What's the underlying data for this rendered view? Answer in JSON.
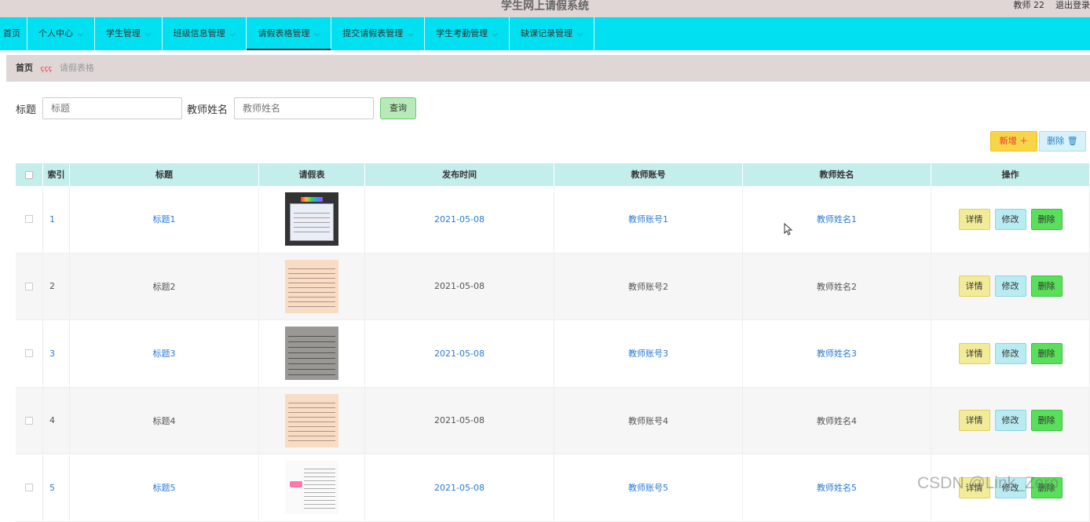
{
  "header": {
    "title": "学生网上请假系统",
    "user": "教师 22",
    "logout": "退出登录"
  },
  "nav": {
    "items": [
      {
        "label": "首页",
        "has_menu": false
      },
      {
        "label": "个人中心",
        "has_menu": true
      },
      {
        "label": "学生管理",
        "has_menu": true
      },
      {
        "label": "班级信息管理",
        "has_menu": true
      },
      {
        "label": "请假表格管理",
        "has_menu": true,
        "active": true
      },
      {
        "label": "提交请假表管理",
        "has_menu": true
      },
      {
        "label": "学生考勤管理",
        "has_menu": true
      },
      {
        "label": "缺课记录管理",
        "has_menu": true
      }
    ],
    "chevron": "⌵"
  },
  "breadcrumb": {
    "home": "首页",
    "separator": "ççç",
    "current": "请假表格"
  },
  "search": {
    "title_label": "标题",
    "title_placeholder": "标题",
    "teacher_label": "教师姓名",
    "teacher_placeholder": "教师姓名",
    "query_button": "查询"
  },
  "actions": {
    "add": "新增 ＋",
    "delete": "删除 🗑"
  },
  "table": {
    "columns": [
      "索引",
      "标题",
      "请假表",
      "发布时间",
      "教师账号",
      "教师姓名",
      "操作"
    ],
    "rows": [
      {
        "index": "1",
        "title": "标题1",
        "date": "2021-05-08",
        "account": "教师账号1",
        "name": "教师姓名1"
      },
      {
        "index": "2",
        "title": "标题2",
        "date": "2021-05-08",
        "account": "教师账号2",
        "name": "教师姓名2"
      },
      {
        "index": "3",
        "title": "标题3",
        "date": "2021-05-08",
        "account": "教师账号3",
        "name": "教师姓名3"
      },
      {
        "index": "4",
        "title": "标题4",
        "date": "2021-05-08",
        "account": "教师账号4",
        "name": "教师姓名4"
      },
      {
        "index": "5",
        "title": "标题5",
        "date": "2021-05-08",
        "account": "教师账号5",
        "name": "教师姓名5"
      }
    ],
    "row_buttons": {
      "detail": "详情",
      "edit": "修改",
      "delete": "删除"
    }
  },
  "watermark": "CSDN @Link_Zero"
}
